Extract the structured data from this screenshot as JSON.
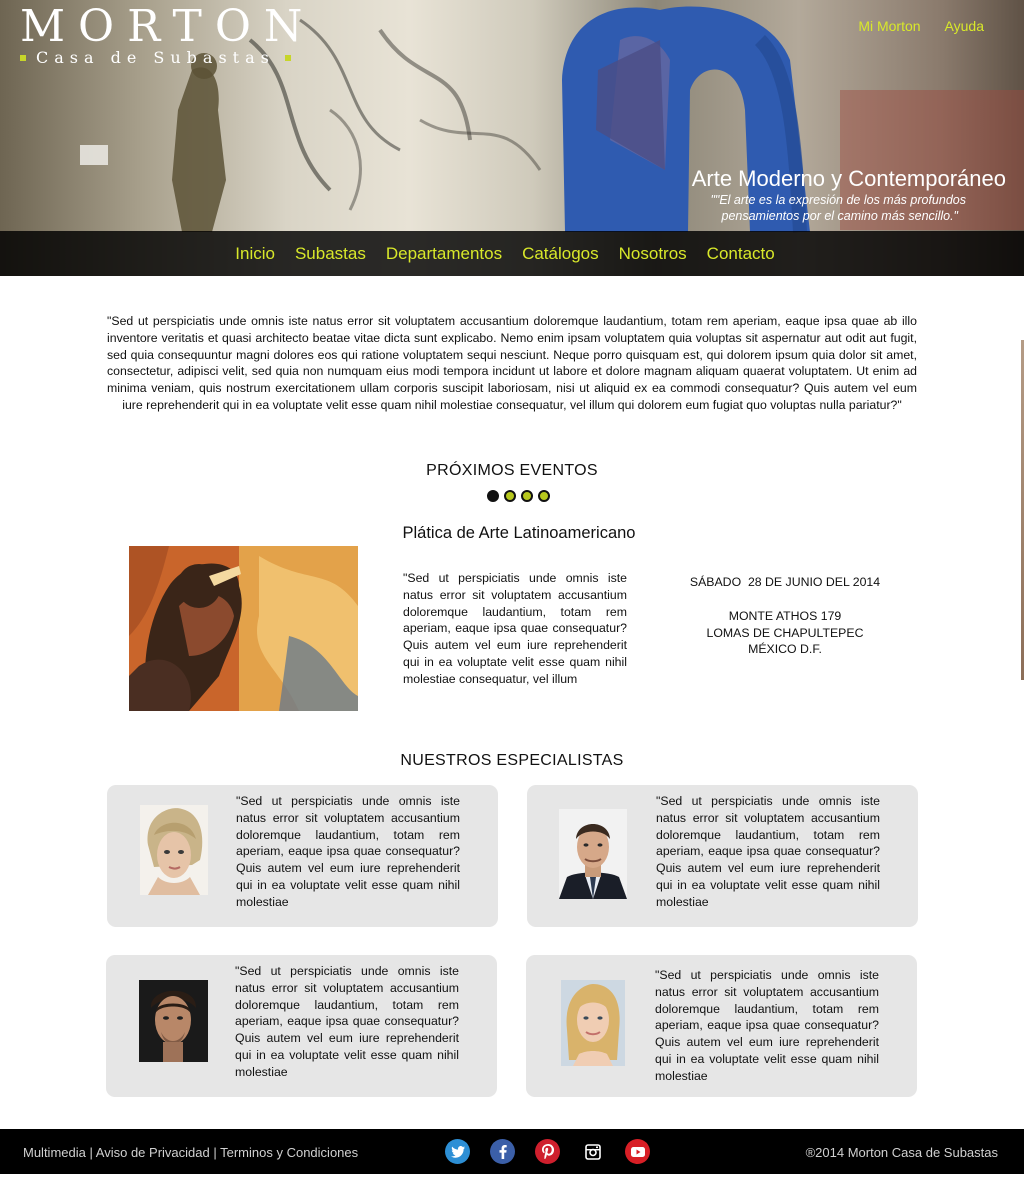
{
  "header": {
    "logo": {
      "name": "MORTON",
      "subtitle": "Casa de Subastas"
    },
    "top_links": [
      "Mi Morton",
      "Ayuda"
    ],
    "tagline": {
      "title": "Arte Moderno y Contemporáneo",
      "quote_line1": "\"\"El arte es la expresión de los más profundos",
      "quote_line2": "pensamientos por el camino más sencillo.\""
    },
    "nav": [
      "Inicio",
      "Subastas",
      "Departamentos",
      "Catálogos",
      "Nosotros",
      "Contacto"
    ]
  },
  "intro": "\"Sed ut perspiciatis unde omnis iste natus error sit voluptatem accusantium doloremque laudantium, totam rem aperiam, eaque ipsa quae ab illo inventore veritatis et quasi architecto beatae vitae dicta sunt explicabo. Nemo enim ipsam voluptatem quia voluptas sit aspernatur aut odit aut fugit, sed quia consequuntur magni dolores eos qui ratione voluptatem sequi nesciunt. Neque porro quisquam est, qui dolorem ipsum quia dolor sit amet, consectetur, adipisci velit, sed quia non numquam eius modi tempora incidunt ut labore et dolore magnam aliquam quaerat voluptatem. Ut enim ad minima veniam, quis nostrum exercitationem ullam corporis suscipit laboriosam, nisi ut aliquid ex ea commodi consequatur? Quis autem vel eum iure reprehenderit qui in ea voluptate velit esse quam nihil molestiae consequatur, vel illum qui dolorem eum fugiat quo voluptas nulla pariatur?\"",
  "events": {
    "section_title": "PRÓXIMOS EVENTOS",
    "carousel_active_index": 0,
    "carousel_count": 4,
    "event": {
      "title": "Plática de Arte Latinoamericano",
      "description": "\"Sed ut perspiciatis unde omnis iste natus error sit voluptatem accusantium doloremque laudantium, totam rem aperiam, eaque ipsa quae consequatur? Quis autem vel eum iure reprehenderit qui in ea voluptate velit esse quam nihil molestiae consequatur, vel illum",
      "date": "SÁBADO  28 DE JUNIO DEL 2014",
      "address_line1": "MONTE ATHOS 179",
      "address_line2": "LOMAS DE CHAPULTEPEC",
      "address_line3": "MÉXICO D.F."
    }
  },
  "specialists": {
    "section_title": "NUESTROS ESPECIALISTAS",
    "items": [
      {
        "bio": "\"Sed ut perspiciatis unde omnis iste natus error sit voluptatem accusantium doloremque laudantium, totam rem aperiam, eaque ipsa quae consequatur? Quis autem vel eum iure reprehenderit qui in ea voluptate velit esse quam nihil molestiae"
      },
      {
        "bio": "\"Sed ut perspiciatis unde omnis iste natus error sit voluptatem accusantium doloremque laudantium, totam rem aperiam, eaque ipsa quae consequatur? Quis autem vel eum iure reprehenderit qui in ea voluptate velit esse quam nihil molestiae"
      },
      {
        "bio": "\"Sed ut perspiciatis unde omnis iste natus error sit voluptatem accusantium doloremque laudantium, totam rem aperiam, eaque ipsa quae consequatur? Quis autem vel eum iure reprehenderit qui in ea voluptate velit esse quam nihil molestiae"
      },
      {
        "bio": "\"Sed ut perspiciatis unde omnis iste natus error sit voluptatem accusantium doloremque laudantium, totam rem aperiam, eaque ipsa quae consequatur? Quis autem vel eum iure reprehenderit qui in ea voluptate velit esse quam nihil molestiae"
      }
    ]
  },
  "footer": {
    "link1": "Multimedia",
    "link2": "Aviso de Privacidad",
    "link3": "Terminos y Condiciones",
    "separator": "|",
    "copyright": "®2014 Morton Casa de Subastas",
    "social_icons": [
      "twitter-icon",
      "facebook-icon",
      "pinterest-icon",
      "instagram-icon",
      "youtube-icon"
    ]
  },
  "colors": {
    "accent": "#d8e82a",
    "nav_bar": "#000000",
    "card_bg": "#e6e6e6",
    "footer_bg": "#000000"
  }
}
